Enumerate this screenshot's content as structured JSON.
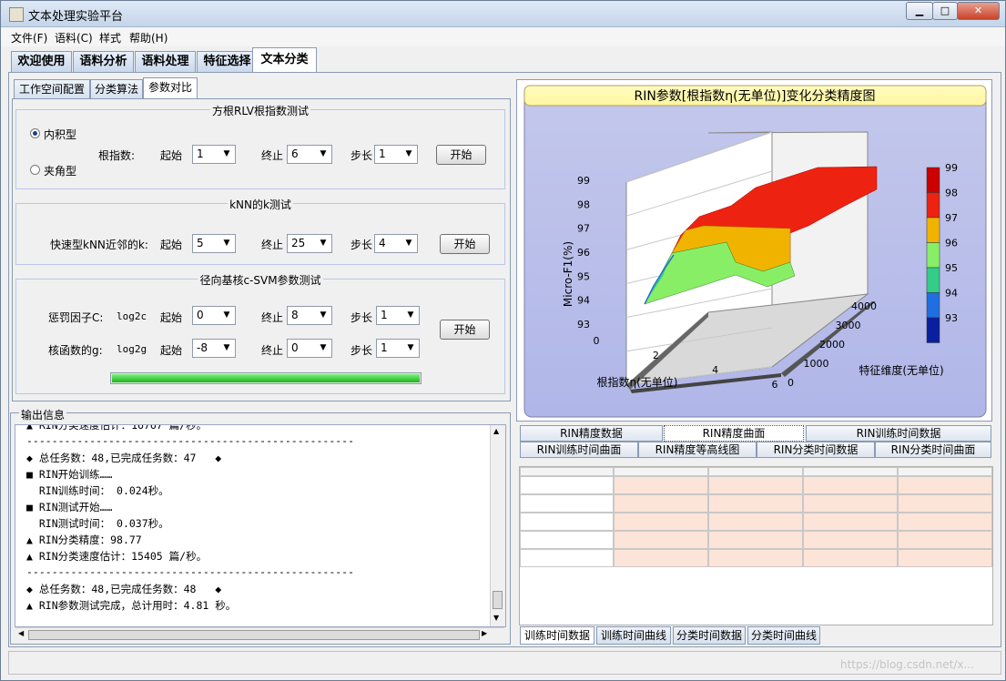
{
  "window": {
    "title": "文本处理实验平台"
  },
  "menu": [
    "文件(F)",
    "语料(C)",
    "样式",
    "帮助(H)"
  ],
  "main_tabs": [
    "欢迎使用",
    "语料分析",
    "语料处理",
    "特征选择",
    "文本分类"
  ],
  "sub_tabs": [
    "工作空间配置",
    "分类算法",
    "参数对比"
  ],
  "group1": {
    "title": "方根RLV根指数测试",
    "radio1": "内积型",
    "radio2": "夹角型",
    "label": "根指数:",
    "start_label": "起始",
    "start_value": "1",
    "end_label": "终止",
    "end_value": "6",
    "step_label": "步长",
    "step_value": "1",
    "button": "开始"
  },
  "group2": {
    "title": "kNN的k测试",
    "label": "快速型kNN近邻的k:",
    "start_label": "起始",
    "start_value": "5",
    "end_label": "终止",
    "end_value": "25",
    "step_label": "步长",
    "step_value": "4",
    "button": "开始"
  },
  "group3": {
    "title": "径向基核c-SVM参数测试",
    "row1_label": "惩罚因子C:",
    "row1_log": "log2c",
    "row1_start_label": "起始",
    "row1_start": "0",
    "row1_end_label": "终止",
    "row1_end": "8",
    "row1_step_label": "步长",
    "row1_step": "1",
    "row2_label": "核函数的g:",
    "row2_log": "log2g",
    "row2_start_label": "起始",
    "row2_start": "-8",
    "row2_end_label": "终止",
    "row2_end": "0",
    "row2_step_label": "步长",
    "row2_step": "1",
    "button": "开始",
    "progress": 1.0
  },
  "output": {
    "title": "输出信息",
    "lines": [
      "▲ RIN分类速度估计：16767 篇/秒。",
      "----------------------------------------------------",
      "◆ 总任务数：48,已完成任务数：47   ◆",
      "■ RIN开始训练……",
      "  RIN训练时间： 0.024秒。",
      "■ RIN测试开始……",
      "  RIN测试时间： 0.037秒。",
      "▲ RIN分类精度：98.77",
      "▲ RIN分类速度估计：15405 篇/秒。",
      "----------------------------------------------------",
      "◆ 总任务数：48,已完成任务数：48   ◆",
      "▲ RIN参数测试完成，总计用时：4.81 秒。"
    ]
  },
  "chart_data": {
    "type": "surface",
    "title": "RIN参数[根指数η(无单位)]变化分类精度图",
    "xlabel": "根指数η(无单位)",
    "ylabel": "特征维度(无单位)",
    "zlabel": "Micro-F1(%)",
    "x_ticks": [
      "0",
      "2",
      "4",
      "6"
    ],
    "y_ticks": [
      "0",
      "1000",
      "2000",
      "3000",
      "4000"
    ],
    "z_ticks": [
      "93",
      "94",
      "95",
      "96",
      "97",
      "98",
      "99"
    ],
    "xlim": [
      0,
      6
    ],
    "ylim": [
      0,
      4000
    ],
    "zlim": [
      93,
      99
    ],
    "colorbar": [
      {
        "label": "99",
        "color": "#cc0000"
      },
      {
        "label": "98",
        "color": "#ee2211"
      },
      {
        "label": "97",
        "color": "#f0b400"
      },
      {
        "label": "96",
        "color": "#88ee66"
      },
      {
        "label": "95",
        "color": "#33cc88"
      },
      {
        "label": "94",
        "color": "#1f6fe0"
      },
      {
        "label": "93",
        "color": "#0a1fa0"
      }
    ],
    "grid": true
  },
  "data_tabs_row1": [
    "RIN精度数据",
    "RIN精度曲面",
    "RIN训练时间数据"
  ],
  "data_tabs_row2": [
    "RIN训练时间曲面",
    "RIN精度等高线图",
    "RIN分类时间数据",
    "RIN分类时间曲面"
  ],
  "bottom_tabs": [
    "训练时间数据",
    "训练时间曲线",
    "分类时间数据",
    "分类时间曲线"
  ],
  "watermark": "https://blog.csdn.net/x..."
}
